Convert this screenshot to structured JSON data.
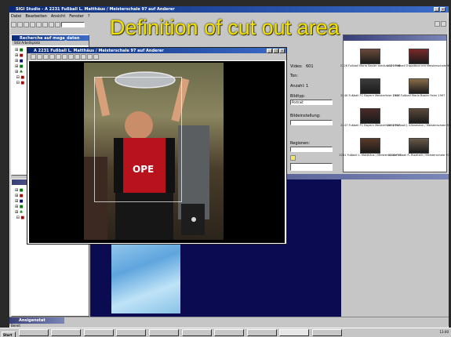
{
  "app": {
    "title": "SIGI Studio - A 2231 Fußball L. Matthäus / Meisterschale 97 auf Anderer"
  },
  "menu": [
    "Datei",
    "Bearbeiten",
    "Ansicht",
    "Fenster",
    "?"
  ],
  "overlay_title": "Definition of cut out area",
  "left_top": {
    "title": "Recherche auf mega_daten",
    "sub": "SIGI Arbeitsplatz"
  },
  "image_win": {
    "title": "A 2231 Fußball L. Matthäus / Meisterschale 97 auf Anderer"
  },
  "form": {
    "video_label": "Video:",
    "video_value": "601",
    "ton_label": "Ton:",
    "anzahl_label": "Anzahl:",
    "anzahl_value": "1",
    "bildtyp_label": "Bildtyp:",
    "bildtyp_value": "Portrait",
    "bildeinstellung_label": "Bildeinstellung:",
    "regionen_label": "Regionen:"
  },
  "thumbs": [
    {
      "caption": "2126 Fußball Mario Basler anhäuschl 1996"
    },
    {
      "caption": "2129 Fußball Trapattoni mit Meisterschale 97"
    },
    {
      "caption": "2140 Fußball FC Bayern Meisterfeier 1997"
    },
    {
      "caption": "2144 Fußball Mario Basler Feier 1997"
    },
    {
      "caption": "2147 Fußball FC Bayern Meisterfeier 1997"
    },
    {
      "caption": "2230 Fußball J. Klinsmann / Meisterschale 97"
    },
    {
      "caption": "2231 Fußball L. Matthäus / Meisterschale 97"
    },
    {
      "caption": "2232 Fußball R. Rizzitelli / Meisterschale 97"
    }
  ],
  "taskbar": {
    "start": "Start",
    "time": "13:40",
    "item1": "Ansigenstat"
  },
  "status": "Bereit",
  "colors": {
    "title_blue": "#0a2a78",
    "overlay_yellow": "#f3e200",
    "navy": "#0b0b52",
    "desktop": "#c6c6c6"
  }
}
